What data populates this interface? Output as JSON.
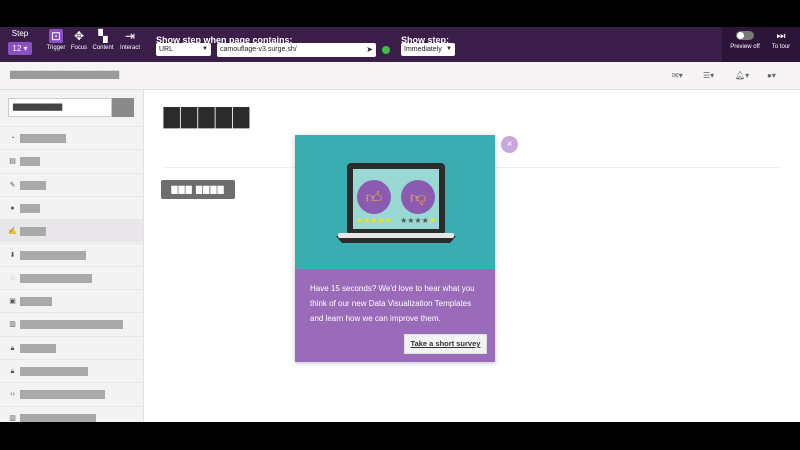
{
  "toolbar": {
    "step_label": "Step",
    "step_value": "12",
    "tools": [
      {
        "label": "Trigger",
        "icon": "trigger-icon"
      },
      {
        "label": "Focus",
        "icon": "crosshair-icon"
      },
      {
        "label": "Content",
        "icon": "content-icon"
      },
      {
        "label": "Interact",
        "icon": "interact-icon"
      }
    ],
    "contains_label": "Show step when page contains:",
    "match_type": "URL",
    "url_value": "camouflage-v3.surge.sh/",
    "show_step_label": "Show step:",
    "show_step_value": "Immediately",
    "preview_label": "Preview off",
    "tour_label": "To tour"
  },
  "header": {
    "title": "▇▇▇▇▇▇▇▇▇▇▇▇▇▇▇▇▇▇▇▇▇"
  },
  "sidebar": {
    "search_placeholder": "▇▇▇▇▇▇▇▇▇▇▇",
    "items": [
      {
        "icon": "dashboard-icon",
        "selected": false
      },
      {
        "icon": "table-icon",
        "selected": false
      },
      {
        "icon": "pencil-icon",
        "selected": false
      },
      {
        "icon": "user-icon",
        "selected": false
      },
      {
        "icon": "edit-icon",
        "selected": true
      },
      {
        "icon": "download-icon",
        "selected": false
      },
      {
        "icon": "spinner-icon",
        "selected": false
      },
      {
        "icon": "image-icon",
        "selected": false
      },
      {
        "icon": "columns-icon",
        "selected": false
      },
      {
        "icon": "lock-icon",
        "selected": false
      },
      {
        "icon": "lock-icon",
        "selected": false
      },
      {
        "icon": "code-icon",
        "selected": false
      },
      {
        "icon": "columns-icon",
        "selected": false
      }
    ]
  },
  "main": {
    "title": "▇▇▇▇▇",
    "button_label": "▇▇▇ ▇▇▇▇"
  },
  "modal": {
    "text": "Have 15 seconds? We'd love to hear what you think of our new Data Visualization Templates and learn how we can improve them.",
    "button_label": "Take a short survey",
    "close_label": "×",
    "top_color": "#3aaeb0",
    "bottom_color": "#9a6bb8"
  }
}
